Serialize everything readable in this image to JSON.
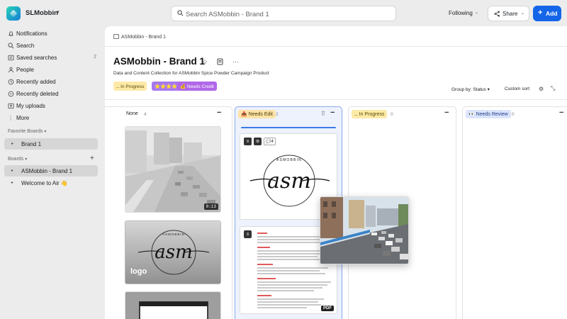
{
  "header": {
    "workspace": "SLMobbin",
    "search_placeholder": "Search ASMobbin - Brand 1",
    "following": "Following",
    "share": "Share",
    "add": "Add"
  },
  "sidebar": {
    "nav": [
      {
        "label": "Notifications",
        "icon": "bell-icon"
      },
      {
        "label": "Search",
        "icon": "search-icon"
      },
      {
        "label": "Saved searches",
        "icon": "saved-search-icon",
        "count": "2"
      },
      {
        "label": "People",
        "icon": "people-icon"
      },
      {
        "label": "Recently added",
        "icon": "clock-icon"
      },
      {
        "label": "Recently deleted",
        "icon": "trash-icon"
      },
      {
        "label": "My uploads",
        "icon": "upload-icon"
      },
      {
        "label": "More",
        "icon": "more-icon"
      }
    ],
    "favorites_label": "Favorite Boards",
    "favorites": [
      {
        "label": "Brand 1"
      }
    ],
    "boards_label": "Boards",
    "boards": [
      {
        "label": "ASMobbin - Brand 1"
      },
      {
        "label": "Welcome to Air 👋"
      }
    ]
  },
  "main": {
    "breadcrumb": "ASMobbin - Brand 1",
    "title": "ASMobbin - Brand 1",
    "description": "Data and Content Collection for ASMobbin Spice Powder Campaign Product",
    "tags": [
      {
        "label": "‥ In Progress",
        "color": "#fdeaa7"
      },
      {
        "label": "⭐⭐⭐⭐",
        "color": "#a878f0"
      },
      {
        "label": "💰 Needs Credit",
        "color": "#b067e8"
      }
    ],
    "group_by": "Group by: Status",
    "custom_sort": "Custom sort"
  },
  "columns": [
    {
      "name": "None",
      "count": "4"
    },
    {
      "name": "📥 Needs Edit",
      "count": "2",
      "color": "#fde3a8"
    },
    {
      "name": "‥ In Progress",
      "count": "0",
      "color": "#fdeaa7"
    },
    {
      "name": "👀 Needs Review",
      "count": "0",
      "color": "#dbe4fb"
    }
  ],
  "cards": {
    "video_duration": "0:13",
    "logo_label": "logo",
    "brand_small": "ASMOBBIN",
    "brand_big": "asm",
    "comment_count": "4",
    "pdf_label": "PDF"
  }
}
